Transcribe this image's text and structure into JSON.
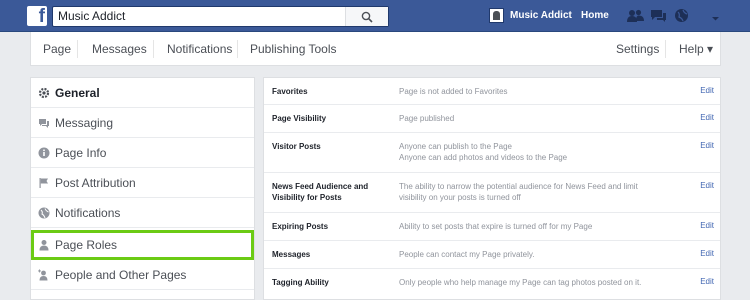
{
  "topbar": {
    "logo": "f",
    "search_value": "Music Addict",
    "search_icon": "search-icon",
    "user_name": "Music Addict",
    "home_label": "Home",
    "icons": [
      "friend-requests-icon",
      "messages-icon",
      "notifications-globe-icon"
    ],
    "caret_icon": "chevron-down-icon",
    "bg_color": "#3b5998"
  },
  "subnav": {
    "page": "Page",
    "messages": "Messages",
    "notifications": "Notifications",
    "publishing_tools": "Publishing Tools",
    "settings": "Settings",
    "help": "Help ▾"
  },
  "menu": {
    "items": [
      {
        "label": "General",
        "icon": "gear-icon",
        "active": true
      },
      {
        "label": "Messaging",
        "icon": "chat-bubble-icon"
      },
      {
        "label": "Page Info",
        "icon": "info-icon"
      },
      {
        "label": "Post Attribution",
        "icon": "flag-icon"
      },
      {
        "label": "Notifications",
        "icon": "globe-icon"
      },
      {
        "label": "Page Roles",
        "icon": "person-icon",
        "highlighted": true
      },
      {
        "label": "People and Other Pages",
        "icon": "person-add-icon"
      }
    ],
    "highlight_color": "#6bcb14"
  },
  "settings": {
    "edit_label": "Edit",
    "rows": [
      {
        "label": "Favorites",
        "value": [
          "Page is not added to Favorites"
        ]
      },
      {
        "label": "Page Visibility",
        "value": [
          "Page published"
        ]
      },
      {
        "label": "Visitor Posts",
        "value": [
          "Anyone can publish to the Page",
          "Anyone can add photos and videos to the Page"
        ]
      },
      {
        "label": "News Feed Audience and Visibility for Posts",
        "value": [
          "The ability to narrow the potential audience for News Feed and limit",
          "visibility on your posts is turned off"
        ]
      },
      {
        "label": "Expiring Posts",
        "value": [
          "Ability to set posts that expire is turned off for my Page"
        ]
      },
      {
        "label": "Messages",
        "value": [
          "People can contact my Page privately."
        ]
      },
      {
        "label": "Tagging Ability",
        "value": [
          "Only people who help manage my Page can tag photos posted on it."
        ]
      }
    ],
    "link_color": "#4267b2"
  }
}
